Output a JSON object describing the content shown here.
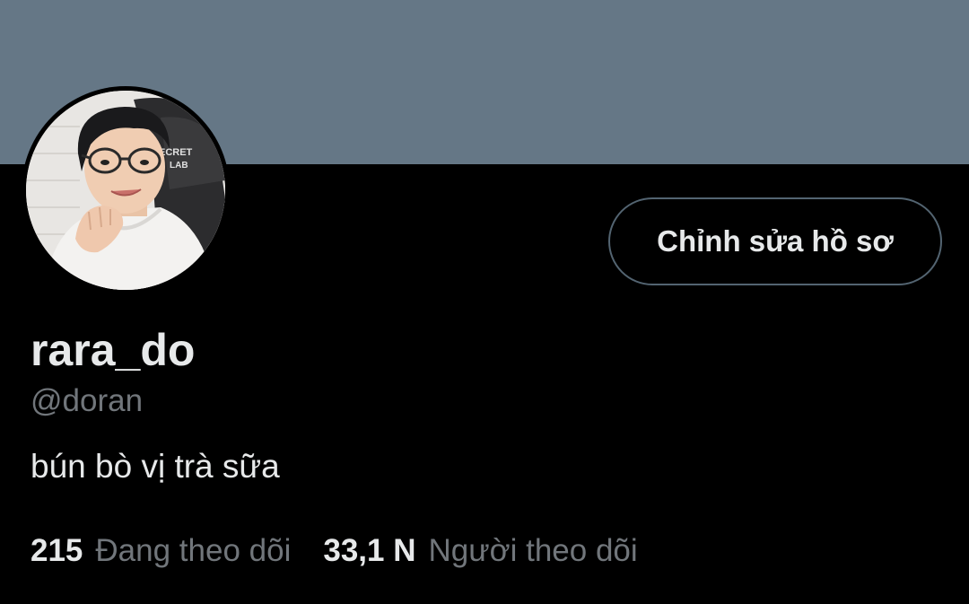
{
  "profile": {
    "display_name": "rara_do",
    "handle": "@doran",
    "bio": "bún bò vị trà sữa",
    "edit_button_label": "Chỉnh sửa hồ sơ",
    "avatar_shirt_text": "ECRET LAB"
  },
  "stats": {
    "following_count": "215",
    "following_label": "Đang theo dõi",
    "followers_count": "33,1 N",
    "followers_label": "Người theo dõi"
  },
  "colors": {
    "banner": "#657786",
    "background": "#000000",
    "primary_text": "#e7e9ea",
    "secondary_text": "#71767b",
    "button_border": "#536471"
  }
}
